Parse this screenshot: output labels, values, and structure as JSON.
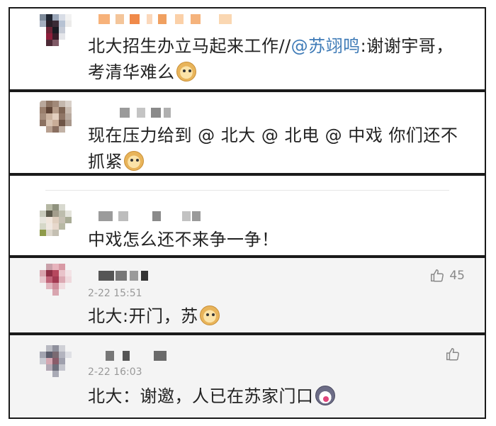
{
  "comments": [
    {
      "text_before": "北大招生办立马起来工作//",
      "mention": "@苏翊鸣",
      "text_after": ":谢谢宇哥，考清华难么"
    },
    {
      "text": "现在压力给到 @ 北大  @ 北电 @ 中戏     你们还不抓紧"
    },
    {
      "text": "中戏怎么还不来争一争！"
    },
    {
      "text": "北大:开门，苏",
      "time": "2-22 15:51",
      "likes": "45"
    },
    {
      "text": "北大：谢邀，人已在苏家门口",
      "time": "2-22 16:03",
      "likes": ""
    }
  ],
  "icons": {
    "emoji_doge": "doge-emoji-icon",
    "emoji_husky": "husky-emoji-icon",
    "like": "thumbs-up-icon"
  },
  "colors": {
    "mention": "#3f7bb7",
    "reply_background": "#f4f4f4",
    "border": "#1a1a1a"
  }
}
